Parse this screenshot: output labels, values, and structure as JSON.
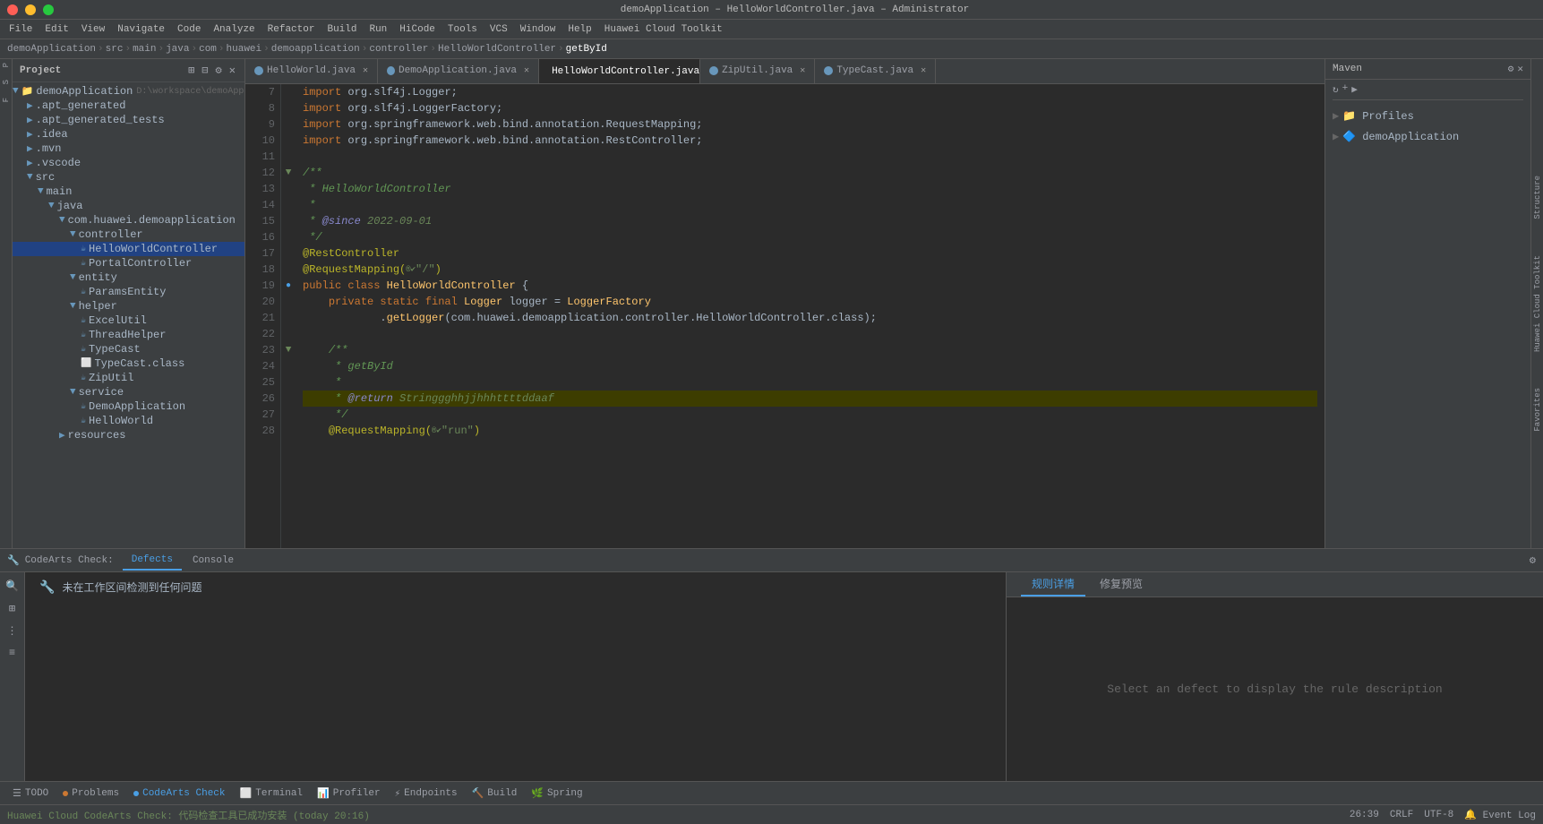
{
  "titleBar": {
    "title": "demoApplication – HelloWorldController.java – Administrator",
    "controls": [
      "close",
      "minimize",
      "maximize"
    ]
  },
  "menuBar": {
    "items": [
      "File",
      "Edit",
      "View",
      "Navigate",
      "Code",
      "Analyze",
      "Refactor",
      "Build",
      "Run",
      "HiCode",
      "Tools",
      "VCS",
      "Window",
      "Help",
      "Huawei Cloud Toolkit"
    ]
  },
  "breadcrumb": {
    "items": [
      "demoApplication",
      "src",
      "main",
      "java",
      "com",
      "huawei",
      "demoapplication",
      "controller",
      "HelloWorldController",
      "getById"
    ]
  },
  "tabs": [
    {
      "label": "HelloWorld.java",
      "active": false,
      "type": "java"
    },
    {
      "label": "DemoApplication.java",
      "active": false,
      "type": "java"
    },
    {
      "label": "HelloWorldController.java",
      "active": true,
      "type": "java"
    },
    {
      "label": "ZipUtil.java",
      "active": false,
      "type": "java"
    },
    {
      "label": "TypeCast.java",
      "active": false,
      "type": "java"
    }
  ],
  "projectPanel": {
    "title": "Project",
    "root": "demoApplication",
    "rootPath": "D:\\workspace\\demoApplication"
  },
  "fileTree": {
    "items": [
      {
        "label": ".apt_generated",
        "type": "folder",
        "depth": 1
      },
      {
        "label": ".apt_generated_tests",
        "type": "folder",
        "depth": 1
      },
      {
        "label": ".idea",
        "type": "folder",
        "depth": 1
      },
      {
        "label": ".mvn",
        "type": "folder",
        "depth": 1
      },
      {
        "label": ".vscode",
        "type": "folder",
        "depth": 1
      },
      {
        "label": "src",
        "type": "folder",
        "depth": 1,
        "expanded": true
      },
      {
        "label": "main",
        "type": "folder",
        "depth": 2,
        "expanded": true
      },
      {
        "label": "java",
        "type": "folder",
        "depth": 3,
        "expanded": true
      },
      {
        "label": "com.huawei.demoapplication",
        "type": "package",
        "depth": 4,
        "expanded": true
      },
      {
        "label": "controller",
        "type": "folder",
        "depth": 5,
        "expanded": true
      },
      {
        "label": "HelloWorldController",
        "type": "java",
        "depth": 6,
        "selected": true
      },
      {
        "label": "PortalController",
        "type": "java",
        "depth": 6
      },
      {
        "label": "entity",
        "type": "folder",
        "depth": 5,
        "expanded": true
      },
      {
        "label": "ParamsEntity",
        "type": "java",
        "depth": 6
      },
      {
        "label": "helper",
        "type": "folder",
        "depth": 5,
        "expanded": true
      },
      {
        "label": "ExcelUtil",
        "type": "java",
        "depth": 6
      },
      {
        "label": "ThreadHelper",
        "type": "java",
        "depth": 6
      },
      {
        "label": "TypeCast",
        "type": "java",
        "depth": 6
      },
      {
        "label": "TypeCast.class",
        "type": "class",
        "depth": 6
      },
      {
        "label": "ZipUtil",
        "type": "java",
        "depth": 6
      },
      {
        "label": "service",
        "type": "folder",
        "depth": 5,
        "expanded": true
      },
      {
        "label": "DemoApplication",
        "type": "java",
        "depth": 6
      },
      {
        "label": "HelloWorld",
        "type": "java",
        "depth": 6
      },
      {
        "label": "resources",
        "type": "folder",
        "depth": 4
      }
    ]
  },
  "codeEditor": {
    "filename": "HelloWorldController.java",
    "lines": [
      {
        "num": "7",
        "content": "import org.slf4j.Logger;"
      },
      {
        "num": "8",
        "content": "import org.slf4j.LoggerFactory;"
      },
      {
        "num": "9",
        "content": "import org.springframework.web.bind.annotation.RequestMapping;"
      },
      {
        "num": "10",
        "content": "import org.springframework.web.bind.annotation.RestController;"
      },
      {
        "num": "11",
        "content": ""
      },
      {
        "num": "12",
        "content": "/**"
      },
      {
        "num": "13",
        "content": " * HelloWorldController"
      },
      {
        "num": "14",
        "content": " *"
      },
      {
        "num": "15",
        "content": " * @since 2022-09-01"
      },
      {
        "num": "16",
        "content": " */"
      },
      {
        "num": "17",
        "content": "@RestController"
      },
      {
        "num": "18",
        "content": "@RequestMapping(®✔\"/) "
      },
      {
        "num": "19",
        "content": "public class HelloWorldController {"
      },
      {
        "num": "20",
        "content": "    private static final Logger logger = LoggerFactory"
      },
      {
        "num": "21",
        "content": "            .getLogger(com.huawei.demoapplication.controller.HelloWorldController.class);"
      },
      {
        "num": "22",
        "content": ""
      },
      {
        "num": "23",
        "content": "    /**"
      },
      {
        "num": "24",
        "content": "     * getById"
      },
      {
        "num": "25",
        "content": "     *"
      },
      {
        "num": "26",
        "content": "     * @return Stringgghhjjhhhttttddaaf"
      },
      {
        "num": "27",
        "content": "     */"
      },
      {
        "num": "28",
        "content": "    @RequestMapping(®✔\"run\")"
      }
    ]
  },
  "mavenPanel": {
    "title": "Maven",
    "items": [
      {
        "label": "Profiles",
        "type": "folder"
      },
      {
        "label": "demoApplication",
        "type": "project"
      }
    ]
  },
  "bottomTabs": {
    "items": [
      {
        "label": "CodeArts Check:",
        "type": "label"
      },
      {
        "label": "Defects",
        "active": true
      },
      {
        "label": "Console",
        "active": false
      }
    ]
  },
  "defects": {
    "message": "未在工作区间检测到任何问题",
    "ruleDescTabs": [
      {
        "label": "规则详情",
        "active": true
      },
      {
        "label": "修复预览",
        "active": false
      }
    ],
    "placeholder": "Select an defect to display the rule description"
  },
  "bottomToolbar": {
    "items": [
      {
        "label": "TODO",
        "icon": "list-icon"
      },
      {
        "label": "Problems",
        "icon": "dot-orange",
        "badge": ""
      },
      {
        "label": "CodeArts Check",
        "icon": "dot-blue",
        "active": true
      },
      {
        "label": "Terminal",
        "icon": "terminal-icon"
      },
      {
        "label": "Profiler",
        "icon": "profiler-icon"
      },
      {
        "label": "Endpoints",
        "icon": "endpoints-icon"
      },
      {
        "label": "Build",
        "icon": "build-icon"
      },
      {
        "label": "Spring",
        "icon": "spring-icon"
      }
    ]
  },
  "statusBar": {
    "leftItems": [
      {
        "label": "Huawei Cloud CodeArts Check: 代码检查工具已成功安装 (today 20:16)",
        "type": "success"
      }
    ],
    "rightItems": [
      {
        "label": "26:39"
      },
      {
        "label": "CRLF"
      },
      {
        "label": "UTF-8"
      },
      {
        "label": "Event Log"
      }
    ]
  }
}
